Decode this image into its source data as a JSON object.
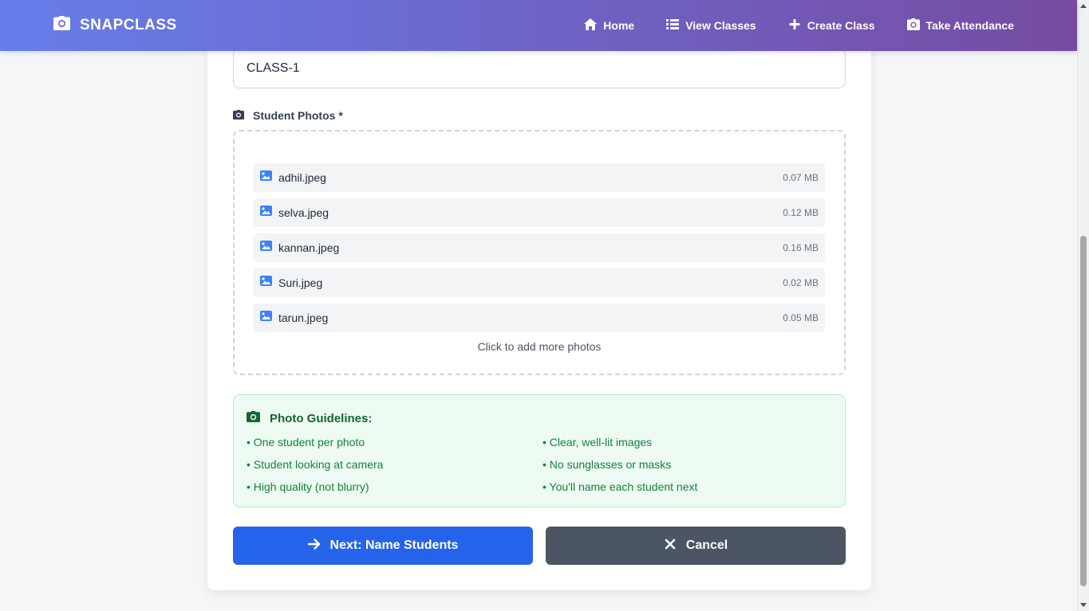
{
  "navbar": {
    "brand": "SNAPCLASS",
    "links": [
      {
        "label": "Home",
        "icon": "home-icon"
      },
      {
        "label": "View Classes",
        "icon": "list-icon"
      },
      {
        "label": "Create Class",
        "icon": "plus-icon"
      },
      {
        "label": "Take Attendance",
        "icon": "camera-icon"
      }
    ]
  },
  "form": {
    "class_name_value": "CLASS-1",
    "photos_label": "Student Photos *",
    "files": [
      {
        "name": "adhil.jpeg",
        "size": "0.07 MB"
      },
      {
        "name": "selva.jpeg",
        "size": "0.12 MB"
      },
      {
        "name": "kannan.jpeg",
        "size": "0.16 MB"
      },
      {
        "name": "Suri.jpeg",
        "size": "0.02 MB"
      },
      {
        "name": "tarun.jpeg",
        "size": "0.05 MB"
      }
    ],
    "add_more_text": "Click to add more photos"
  },
  "guidelines": {
    "title": "Photo Guidelines:",
    "items": [
      "• One student per photo",
      "• Clear, well-lit images",
      "• Student looking at camera",
      "• No sunglasses or masks",
      "• High quality (not blurry)",
      "• You'll name each student next"
    ]
  },
  "actions": {
    "next_label": "Next: Name Students",
    "cancel_label": "Cancel"
  },
  "colors": {
    "nav_gradient_start": "#667eea",
    "nav_gradient_end": "#764ba2",
    "primary": "#2563eb",
    "secondary": "#4b5563",
    "success_text": "#15803d",
    "success_bg": "#edfbf2"
  }
}
